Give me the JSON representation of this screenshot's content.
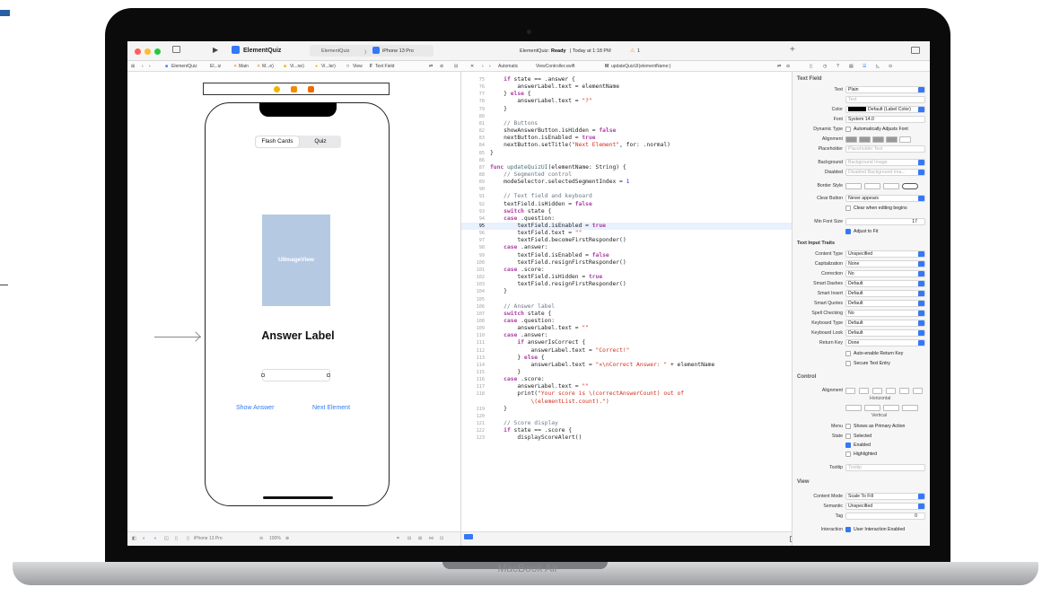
{
  "window": {
    "scheme": "ElementQuiz",
    "breadcrumb_app": "ElementQuiz",
    "device": "iPhone 13 Pro",
    "status_prefix": "ElementQuiz:",
    "status_state": "Ready",
    "status_time": "| Today at 1:18 PM",
    "warning_count": "1"
  },
  "jumpbar": {
    "left": [
      "ElementQuiz",
      "El...iz",
      "Main",
      "M...e)",
      "Vi...ne)",
      "Vi...ler)",
      "View",
      "Text Field"
    ],
    "right": [
      "Automatic",
      "ViewController.swift",
      "updateQuizUI(elementName:)"
    ]
  },
  "canvas": {
    "segments": [
      "Flash Cards",
      "Quiz"
    ],
    "image_view": "UIImageView",
    "answer_label": "Answer Label",
    "show_answer": "Show Answer",
    "next_element": "Next Element",
    "bottom_device": "iPhone 13 Pro",
    "zoom": "100%"
  },
  "brand": "MacBook Air",
  "code_lines": [
    {
      "n": "75",
      "t": "    <k>if</k> state == .answer {"
    },
    {
      "n": "76",
      "t": "        answerLabel.text = elementName"
    },
    {
      "n": "77",
      "t": "    } <k>else</k> {"
    },
    {
      "n": "78",
      "t": "        answerLabel.text = <s>\"?\"</s>"
    },
    {
      "n": "79",
      "t": "    }"
    },
    {
      "n": "80",
      "t": ""
    },
    {
      "n": "81",
      "t": "    <c>// Buttons</c>"
    },
    {
      "n": "82",
      "t": "    showAnswerButton.isHidden = <k>false</k>"
    },
    {
      "n": "83",
      "t": "    nextButton.isEnabled = <k>true</k>"
    },
    {
      "n": "84",
      "t": "    nextButton.setTitle(<s>\"Next Element\"</s>, for: .normal)"
    },
    {
      "n": "85",
      "t": "}"
    },
    {
      "n": "86",
      "t": ""
    },
    {
      "n": "87",
      "t": "<k>func</k> <f>updateQuizUI</f>(elementName: String) {"
    },
    {
      "n": "88",
      "t": "    <c>// Segmented control</c>"
    },
    {
      "n": "89",
      "t": "    modeSelector.selectedSegmentIndex = <n>1</n>"
    },
    {
      "n": "90",
      "t": ""
    },
    {
      "n": "91",
      "t": "    <c>// Text field and keyboard</c>"
    },
    {
      "n": "92",
      "t": "    textField.isHidden = <k>false</k>"
    },
    {
      "n": "93",
      "t": "    <k>switch</k> state {"
    },
    {
      "n": "94",
      "t": "    <k>case</k> .question:"
    },
    {
      "n": "95",
      "t": "        textField.isEnabled = <k>true</k>",
      "hl": true
    },
    {
      "n": "96",
      "t": "        textField.text = <s>\"\"</s>"
    },
    {
      "n": "97",
      "t": "        textField.becomeFirstResponder()"
    },
    {
      "n": "98",
      "t": "    <k>case</k> .answer:"
    },
    {
      "n": "99",
      "t": "        textField.isEnabled = <k>false</k>"
    },
    {
      "n": "100",
      "t": "        textField.resignFirstResponder()"
    },
    {
      "n": "101",
      "t": "    <k>case</k> .score:"
    },
    {
      "n": "102",
      "t": "        textField.isHidden = <k>true</k>"
    },
    {
      "n": "103",
      "t": "        textField.resignFirstResponder()"
    },
    {
      "n": "104",
      "t": "    }"
    },
    {
      "n": "105",
      "t": ""
    },
    {
      "n": "106",
      "t": "    <c>// Answer label</c>"
    },
    {
      "n": "107",
      "t": "    <k>switch</k> state {"
    },
    {
      "n": "108",
      "t": "    <k>case</k> .question:"
    },
    {
      "n": "109",
      "t": "        answerLabel.text = <s>\"\"</s>"
    },
    {
      "n": "110",
      "t": "    <k>case</k> .answer:"
    },
    {
      "n": "111",
      "t": "        <k>if</k> answerIsCorrect {"
    },
    {
      "n": "112",
      "t": "            answerLabel.text = <s>\"Correct!\"</s>"
    },
    {
      "n": "113",
      "t": "        } <k>else</k> {"
    },
    {
      "n": "114",
      "t": "            answerLabel.text = <s>\"</s><x>✕</x><s>\\nCorrect Answer: \"</s> + elementName"
    },
    {
      "n": "115",
      "t": "        }"
    },
    {
      "n": "116",
      "t": "    <k>case</k> .score:"
    },
    {
      "n": "117",
      "t": "        answerLabel.text = <s>\"\"</s>"
    },
    {
      "n": "118",
      "t": "        print(<s>\"Your score is \\(correctAnswerCount) out of</s>"
    },
    {
      "n": "",
      "t": "<s>            \\(elementList.count).\")</s>"
    },
    {
      "n": "119",
      "t": "    }"
    },
    {
      "n": "120",
      "t": ""
    },
    {
      "n": "121",
      "t": "    <c>// Score display</c>"
    },
    {
      "n": "122",
      "t": "    <k>if</k> state == .score {"
    },
    {
      "n": "123",
      "t": "        displayScoreAlert()"
    }
  ],
  "inspector": {
    "text_field_header": "Text Field",
    "text_label": "Text",
    "text_value": "Plain",
    "text_placeholder": "Text",
    "color_label": "Color",
    "color_value": "Default (Label Color)",
    "font_label": "Font",
    "font_value": "System 14.0",
    "dynamic_label": "Dynamic Type",
    "dynamic_value": "Automatically Adjusts Font",
    "alignment_label": "Alignment",
    "placeholder_label": "Placeholder",
    "placeholder_value": "Placeholder Text",
    "background_label": "Background",
    "background_value": "Background Image",
    "disabled_label": "Disabled",
    "disabled_value": "Disabled Background Ima...",
    "border_label": "Border Style",
    "clear_label": "Clear Button",
    "clear_value": "Never appears",
    "clear_editing": "Clear when editing begins",
    "minfont_label": "Min Font Size",
    "minfont_value": "17",
    "adjust": "Adjust to Fit",
    "traits_header": "Text Input Traits",
    "traits": [
      {
        "label": "Content Type",
        "value": "Unspecified"
      },
      {
        "label": "Capitalization",
        "value": "None"
      },
      {
        "label": "Correction",
        "value": "No"
      },
      {
        "label": "Smart Dashes",
        "value": "Default"
      },
      {
        "label": "Smart Insert",
        "value": "Default"
      },
      {
        "label": "Smart Quotes",
        "value": "Default"
      },
      {
        "label": "Spell Checking",
        "value": "No"
      },
      {
        "label": "Keyboard Type",
        "value": "Default"
      },
      {
        "label": "Keyboard Look",
        "value": "Default"
      },
      {
        "label": "Return Key",
        "value": "Done"
      }
    ],
    "auto_return": "Auto-enable Return Key",
    "secure": "Secure Text Entry",
    "control_header": "Control",
    "ctrl_alignment_label": "Alignment",
    "horizontal": "Horizontal",
    "vertical": "Vertical",
    "menu_label": "Menu",
    "menu_value": "Shows as Primary Action",
    "state_label": "State",
    "selected": "Selected",
    "enabled": "Enabled",
    "highlighted": "Highlighted",
    "tooltip_label": "Tooltip",
    "tooltip_value": "Tooltip",
    "view_header": "View",
    "content_mode_label": "Content Mode",
    "content_mode_value": "Scale To Fill",
    "semantic_label": "Semantic",
    "semantic_value": "Unspecified",
    "tag_label": "Tag",
    "tag_value": "0",
    "interaction_label": "Interaction",
    "interaction_value": "User Interaction Enabled"
  },
  "colors": {
    "accent": "#3478f6",
    "keyword": "#ad3da4",
    "string": "#d12f1b",
    "comment": "#6c7986"
  }
}
